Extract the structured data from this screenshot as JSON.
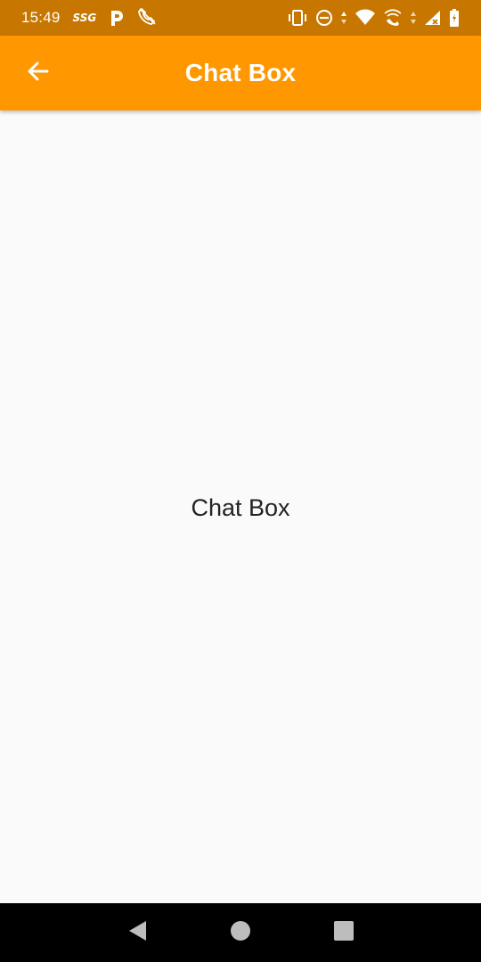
{
  "status_bar": {
    "time": "15:49",
    "carrier_label": "SSG",
    "icons": [
      "ssg-icon",
      "p-app-icon",
      "phone-off-icon",
      "vibrate-icon",
      "dnd-icon",
      "data-arrows-icon",
      "wifi-icon",
      "wifi-calling-icon",
      "signal-icon",
      "battery-icon"
    ],
    "color": "#c77700"
  },
  "app_bar": {
    "title": "Chat Box",
    "back_icon": "arrow-back-icon",
    "color": "#ff9800"
  },
  "content": {
    "center_text": "Chat Box"
  },
  "nav_bar": {
    "buttons": [
      "back-triangle-icon",
      "home-circle-icon",
      "recents-square-icon"
    ]
  }
}
